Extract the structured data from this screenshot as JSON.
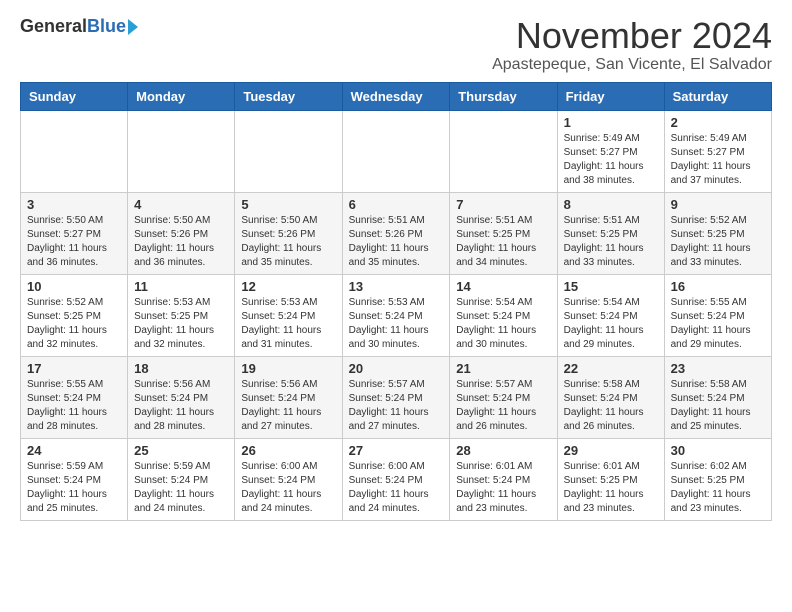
{
  "header": {
    "logo_general": "General",
    "logo_blue": "Blue",
    "month_title": "November 2024",
    "location": "Apastepeque, San Vicente, El Salvador"
  },
  "weekdays": [
    "Sunday",
    "Monday",
    "Tuesday",
    "Wednesday",
    "Thursday",
    "Friday",
    "Saturday"
  ],
  "weeks": [
    [
      {
        "day": "",
        "info": ""
      },
      {
        "day": "",
        "info": ""
      },
      {
        "day": "",
        "info": ""
      },
      {
        "day": "",
        "info": ""
      },
      {
        "day": "",
        "info": ""
      },
      {
        "day": "1",
        "info": "Sunrise: 5:49 AM\nSunset: 5:27 PM\nDaylight: 11 hours\nand 38 minutes."
      },
      {
        "day": "2",
        "info": "Sunrise: 5:49 AM\nSunset: 5:27 PM\nDaylight: 11 hours\nand 37 minutes."
      }
    ],
    [
      {
        "day": "3",
        "info": "Sunrise: 5:50 AM\nSunset: 5:27 PM\nDaylight: 11 hours\nand 36 minutes."
      },
      {
        "day": "4",
        "info": "Sunrise: 5:50 AM\nSunset: 5:26 PM\nDaylight: 11 hours\nand 36 minutes."
      },
      {
        "day": "5",
        "info": "Sunrise: 5:50 AM\nSunset: 5:26 PM\nDaylight: 11 hours\nand 35 minutes."
      },
      {
        "day": "6",
        "info": "Sunrise: 5:51 AM\nSunset: 5:26 PM\nDaylight: 11 hours\nand 35 minutes."
      },
      {
        "day": "7",
        "info": "Sunrise: 5:51 AM\nSunset: 5:25 PM\nDaylight: 11 hours\nand 34 minutes."
      },
      {
        "day": "8",
        "info": "Sunrise: 5:51 AM\nSunset: 5:25 PM\nDaylight: 11 hours\nand 33 minutes."
      },
      {
        "day": "9",
        "info": "Sunrise: 5:52 AM\nSunset: 5:25 PM\nDaylight: 11 hours\nand 33 minutes."
      }
    ],
    [
      {
        "day": "10",
        "info": "Sunrise: 5:52 AM\nSunset: 5:25 PM\nDaylight: 11 hours\nand 32 minutes."
      },
      {
        "day": "11",
        "info": "Sunrise: 5:53 AM\nSunset: 5:25 PM\nDaylight: 11 hours\nand 32 minutes."
      },
      {
        "day": "12",
        "info": "Sunrise: 5:53 AM\nSunset: 5:24 PM\nDaylight: 11 hours\nand 31 minutes."
      },
      {
        "day": "13",
        "info": "Sunrise: 5:53 AM\nSunset: 5:24 PM\nDaylight: 11 hours\nand 30 minutes."
      },
      {
        "day": "14",
        "info": "Sunrise: 5:54 AM\nSunset: 5:24 PM\nDaylight: 11 hours\nand 30 minutes."
      },
      {
        "day": "15",
        "info": "Sunrise: 5:54 AM\nSunset: 5:24 PM\nDaylight: 11 hours\nand 29 minutes."
      },
      {
        "day": "16",
        "info": "Sunrise: 5:55 AM\nSunset: 5:24 PM\nDaylight: 11 hours\nand 29 minutes."
      }
    ],
    [
      {
        "day": "17",
        "info": "Sunrise: 5:55 AM\nSunset: 5:24 PM\nDaylight: 11 hours\nand 28 minutes."
      },
      {
        "day": "18",
        "info": "Sunrise: 5:56 AM\nSunset: 5:24 PM\nDaylight: 11 hours\nand 28 minutes."
      },
      {
        "day": "19",
        "info": "Sunrise: 5:56 AM\nSunset: 5:24 PM\nDaylight: 11 hours\nand 27 minutes."
      },
      {
        "day": "20",
        "info": "Sunrise: 5:57 AM\nSunset: 5:24 PM\nDaylight: 11 hours\nand 27 minutes."
      },
      {
        "day": "21",
        "info": "Sunrise: 5:57 AM\nSunset: 5:24 PM\nDaylight: 11 hours\nand 26 minutes."
      },
      {
        "day": "22",
        "info": "Sunrise: 5:58 AM\nSunset: 5:24 PM\nDaylight: 11 hours\nand 26 minutes."
      },
      {
        "day": "23",
        "info": "Sunrise: 5:58 AM\nSunset: 5:24 PM\nDaylight: 11 hours\nand 25 minutes."
      }
    ],
    [
      {
        "day": "24",
        "info": "Sunrise: 5:59 AM\nSunset: 5:24 PM\nDaylight: 11 hours\nand 25 minutes."
      },
      {
        "day": "25",
        "info": "Sunrise: 5:59 AM\nSunset: 5:24 PM\nDaylight: 11 hours\nand 24 minutes."
      },
      {
        "day": "26",
        "info": "Sunrise: 6:00 AM\nSunset: 5:24 PM\nDaylight: 11 hours\nand 24 minutes."
      },
      {
        "day": "27",
        "info": "Sunrise: 6:00 AM\nSunset: 5:24 PM\nDaylight: 11 hours\nand 24 minutes."
      },
      {
        "day": "28",
        "info": "Sunrise: 6:01 AM\nSunset: 5:24 PM\nDaylight: 11 hours\nand 23 minutes."
      },
      {
        "day": "29",
        "info": "Sunrise: 6:01 AM\nSunset: 5:25 PM\nDaylight: 11 hours\nand 23 minutes."
      },
      {
        "day": "30",
        "info": "Sunrise: 6:02 AM\nSunset: 5:25 PM\nDaylight: 11 hours\nand 23 minutes."
      }
    ]
  ]
}
